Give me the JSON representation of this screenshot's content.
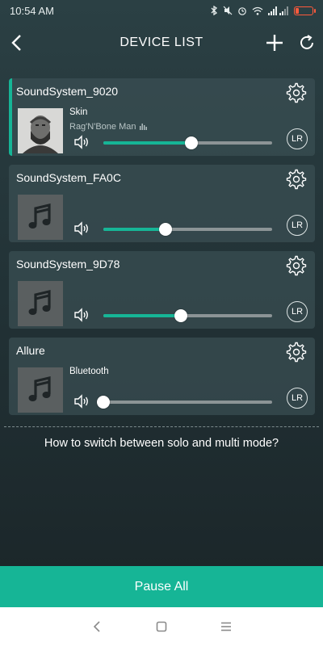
{
  "status_bar": {
    "time": "10:54 AM",
    "icons": [
      "bluetooth-icon",
      "mute-icon",
      "alarm-icon",
      "wifi-icon",
      "signal-icon",
      "battery-icon"
    ]
  },
  "header": {
    "title": "DEVICE LIST",
    "back_icon": "chevron-left-icon",
    "add_icon": "plus-icon",
    "refresh_icon": "refresh-icon"
  },
  "devices": [
    {
      "name": "SoundSystem_9020",
      "track_title": "Skin",
      "track_artist": "Rag'N'Bone Man",
      "volume": 0.52,
      "channel": "LR",
      "active": true,
      "has_art": true
    },
    {
      "name": "SoundSystem_FA0C",
      "track_title": "",
      "track_artist": "",
      "volume": 0.37,
      "channel": "LR",
      "active": false,
      "has_art": false
    },
    {
      "name": "SoundSystem_9D78",
      "track_title": "",
      "track_artist": "",
      "volume": 0.46,
      "channel": "LR",
      "active": false,
      "has_art": false
    },
    {
      "name": "Allure",
      "track_title": "Bluetooth",
      "track_artist": "",
      "volume": 0.0,
      "channel": "LR",
      "active": false,
      "has_art": false
    }
  ],
  "help_text": "How to switch between solo and multi mode?",
  "pause_button": "Pause All",
  "colors": {
    "accent": "#16b596",
    "card": "#3a4f53",
    "background": "#223236"
  },
  "nav_bar": {
    "items": [
      "back-nav-icon",
      "home-nav-icon",
      "recents-nav-icon"
    ]
  }
}
